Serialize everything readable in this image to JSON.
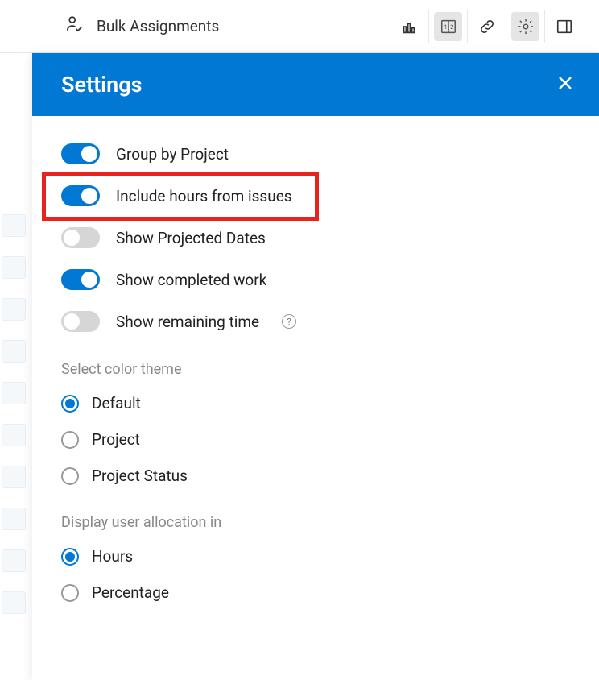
{
  "toolbar": {
    "bulk_assignments_label": "Bulk Assignments"
  },
  "panel": {
    "title": "Settings"
  },
  "toggles": {
    "group_by_project": {
      "label": "Group by Project",
      "on": true
    },
    "include_hours": {
      "label": "Include hours from issues",
      "on": true
    },
    "show_projected": {
      "label": "Show Projected Dates",
      "on": false
    },
    "show_completed": {
      "label": "Show completed work",
      "on": true
    },
    "show_remaining": {
      "label": "Show remaining time",
      "on": false
    }
  },
  "color_theme": {
    "heading": "Select color theme",
    "options": {
      "default": "Default",
      "project": "Project",
      "project_status": "Project Status"
    },
    "selected": "default"
  },
  "allocation": {
    "heading": "Display user allocation in",
    "options": {
      "hours": "Hours",
      "percentage": "Percentage"
    },
    "selected": "hours"
  },
  "icons": {
    "help_glyph": "?"
  }
}
